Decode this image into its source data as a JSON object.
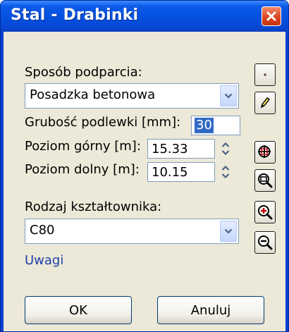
{
  "window": {
    "title": "Stal - Drabinki"
  },
  "form": {
    "support_label": "Sposób podparcia:",
    "support_value": "Posadzka betonowa",
    "grout_label": "Grubość podlewki [mm]:",
    "grout_value": "30",
    "upper_label": "Poziom górny [m]:",
    "upper_value": "15.33",
    "lower_label": "Poziom dolny [m]:",
    "lower_value": "10.15",
    "profile_label": "Rodzaj kształtownika:",
    "profile_value": "C80",
    "notes_link": "Uwagi"
  },
  "buttons": {
    "ok": "OK",
    "cancel": "Anuluj"
  },
  "toolbar": {
    "icons": [
      "point-icon",
      "pencil-icon",
      "zoom-all-icon",
      "zoom-window-icon",
      "zoom-in-icon",
      "zoom-out-icon"
    ]
  },
  "colors": {
    "title_bar": "#0551e0",
    "close_button": "#d8431c",
    "dialog_face": "#ece9d8",
    "selection": "#316ac5",
    "link": "#1d3fa8"
  }
}
